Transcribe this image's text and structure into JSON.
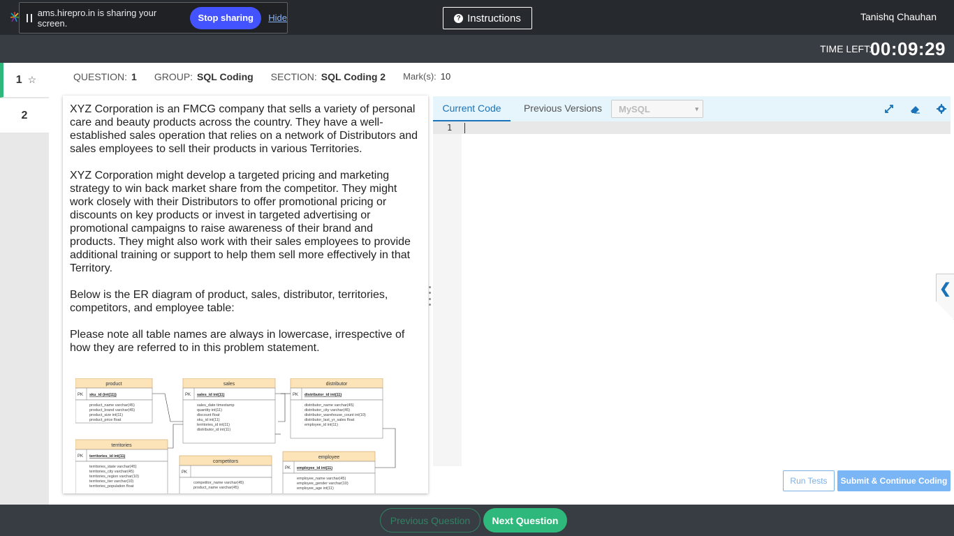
{
  "share_bar": {
    "message": "ams.hirepro.in is sharing your screen.",
    "stop_label": "Stop sharing",
    "hide_label": "Hide"
  },
  "header": {
    "instructions_label": "Instructions",
    "user_name": "Tanishq Chauhan"
  },
  "timer": {
    "label": "TIME LEFT:",
    "value": "00:09:29"
  },
  "question_nav": {
    "items": [
      {
        "label": "1",
        "active": true
      },
      {
        "label": "2",
        "active": false
      }
    ]
  },
  "question_meta": {
    "question_label": "QUESTION:",
    "question_value": "1",
    "group_label": "GROUP:",
    "group_value": "SQL Coding",
    "section_label": "SECTION:",
    "section_value": "SQL Coding 2",
    "marks_label": "Mark(s):",
    "marks_value": "10"
  },
  "question": {
    "paragraphs": [
      "XYZ Corporation is an FMCG company that sells a variety of personal care and beauty products across the country. They have a well-established sales operation that relies on a network of Distributors and sales employees to sell their products in various Territories.",
      "XYZ Corporation might develop a targeted pricing and marketing strategy to win back market share from the competitor. They might work closely with their Distributors to offer promotional pricing or discounts on key products or invest in targeted advertising or promotional campaigns to raise awareness of their brand and products. They might also work with their sales employees to provide additional training or support to help them sell more effectively in that Territory.",
      "Below is the ER diagram of product, sales, distributor, territories, competitors, and employee table:",
      "Please note all table names are always in lowercase, irrespective of how they are referred to in this problem statement."
    ],
    "er_tables": {
      "product": {
        "title": "product",
        "pk": "sku_id (int(11))",
        "fields": [
          "product_name varchar(45)",
          "product_brand varchar(45)",
          "product_size int(11)",
          "product_price float"
        ]
      },
      "sales": {
        "title": "sales",
        "pk": "sales_id int(11)",
        "fields": [
          "sales_date timestamp",
          "quantity int(11)",
          "discount float",
          "sku_id int(11)",
          "territories_id int(11)",
          "distributor_id int(11)"
        ]
      },
      "distributor": {
        "title": "distributor",
        "pk": "distributor_id int(11)",
        "fields": [
          "distributor_name varchar(45)",
          "distributor_city varchar(45)",
          "distributor_warehouse_count int(10)",
          "distributor_last_yr_sales float",
          "employee_id int(11)"
        ]
      },
      "territories": {
        "title": "territories",
        "pk": "territories_id int(11)",
        "fields": [
          "territories_state varchar(45)",
          "territories_city varchar(45)",
          "territories_region varchar(10)",
          "territories_tier varchar(10)",
          "territories_population float"
        ]
      },
      "competitors": {
        "title": "competitors",
        "pk": "",
        "fields": [
          "competitor_name varchar(45)",
          "product_name varchar(45)"
        ]
      },
      "employee": {
        "title": "employee",
        "pk": "employee_id int(11)",
        "fields": [
          "employee_name varchar(45)",
          "employee_gender varchar(10)",
          "employee_age int(11)"
        ]
      }
    },
    "pk_label": "PK"
  },
  "editor": {
    "tab_current": "Current Code",
    "tab_previous": "Previous Versions",
    "language": "MySQL",
    "line_number": "1",
    "run_label": "Run Tests",
    "submit_label": "Submit & Continue Coding"
  },
  "footer": {
    "prev_label": "Previous Question",
    "next_label": "Next Question"
  },
  "colors": {
    "accent_green": "#2eb87b",
    "accent_blue": "#1a73b8",
    "stop_sharing": "#4353ff",
    "er_header": "#fde4b8"
  }
}
